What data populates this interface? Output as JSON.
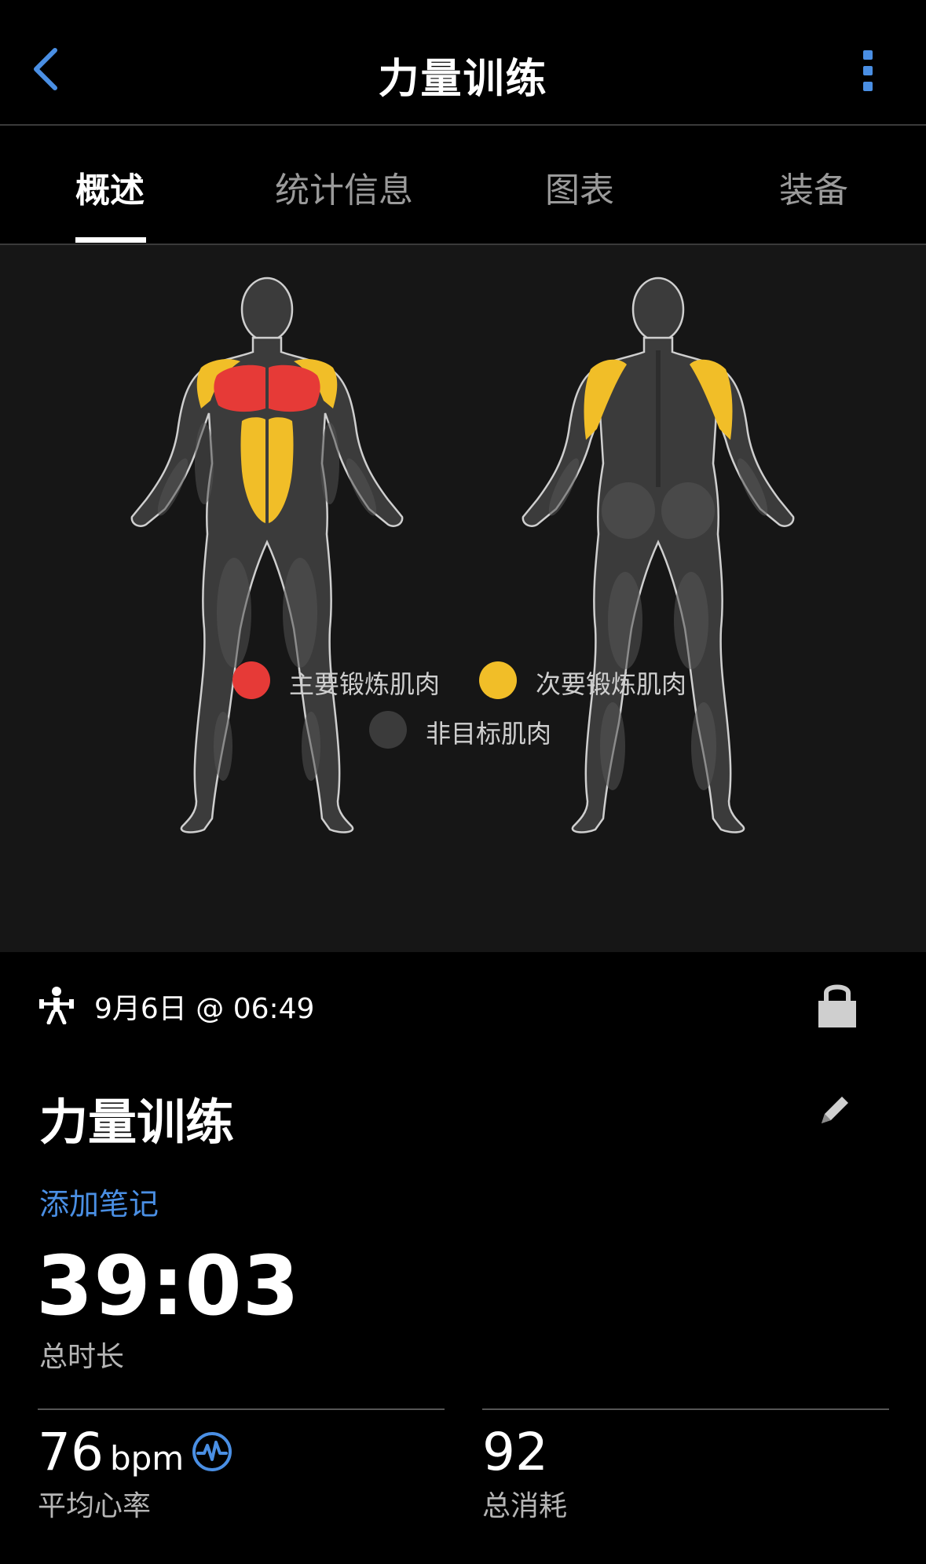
{
  "header": {
    "title": "力量训练"
  },
  "tabs": [
    {
      "label": "概述",
      "active": true
    },
    {
      "label": "统计信息",
      "active": false
    },
    {
      "label": "图表",
      "active": false
    },
    {
      "label": "装备",
      "active": false
    }
  ],
  "legend": {
    "primary": {
      "label": "主要锻炼肌肉",
      "color": "#e63a37"
    },
    "secondary": {
      "label": "次要锻炼肌肉",
      "color": "#f1be28"
    },
    "untargeted": {
      "label": "非目标肌肉",
      "color": "#3b3b3b"
    }
  },
  "activity": {
    "datetime": "9月6日 @ 06:49",
    "title": "力量训练",
    "add_note": "添加笔记",
    "duration": "39:03",
    "duration_label": "总时长",
    "avg_hr_value": "76",
    "avg_hr_unit": "bpm",
    "avg_hr_label": "平均心率",
    "calories_value": "92",
    "calories_label": "总消耗"
  },
  "colors": {
    "accent": "#4a8fe4",
    "background": "#000000",
    "panel": "#161616"
  },
  "icons": {
    "back": "chevron-left-icon",
    "more": "more-vertical-icon",
    "activity": "strength-training-icon",
    "lock": "lock-icon",
    "edit": "pencil-icon",
    "heart_rate": "heart-rate-icon"
  }
}
